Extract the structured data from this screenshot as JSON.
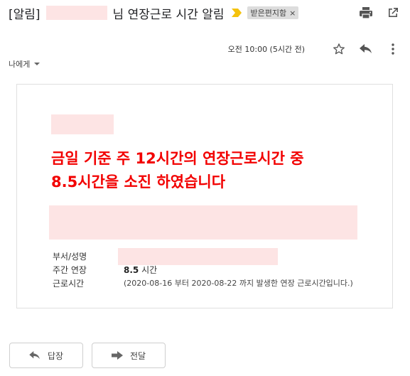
{
  "subject": {
    "prefix": "[알림]",
    "suffix": "님 연장근로 시간 알림",
    "label": "받은편지함",
    "label_close": "×"
  },
  "meta": {
    "time": "오전 10:00 (5시간 전)",
    "recipient": "나에게"
  },
  "body": {
    "headline_line1": "금일 기준 주 12시간의 연장근로시간 중",
    "headline_line2": "8.5시간을 소진 하였습니다",
    "rows": [
      {
        "key": "부서/성명",
        "value": ""
      },
      {
        "key": "주간 연장",
        "value_bold": "8.5",
        "value_unit": " 시간"
      },
      {
        "key": "근로시간",
        "value": "(2020-08-16 부터 2020-08-22 까지 발생한 연장 근로시간입니다.)"
      }
    ]
  },
  "actions": {
    "reply": "답장",
    "forward": "전달"
  },
  "icons": {
    "print": "print-icon",
    "popout": "open-in-new-window-icon",
    "star": "star-icon",
    "reply": "reply-icon",
    "more": "more-vertical-icon",
    "importance": "importance-marker-icon"
  },
  "colors": {
    "headline": "#f20000",
    "redaction": "#fde4e4",
    "importance": "#f4c20d"
  }
}
